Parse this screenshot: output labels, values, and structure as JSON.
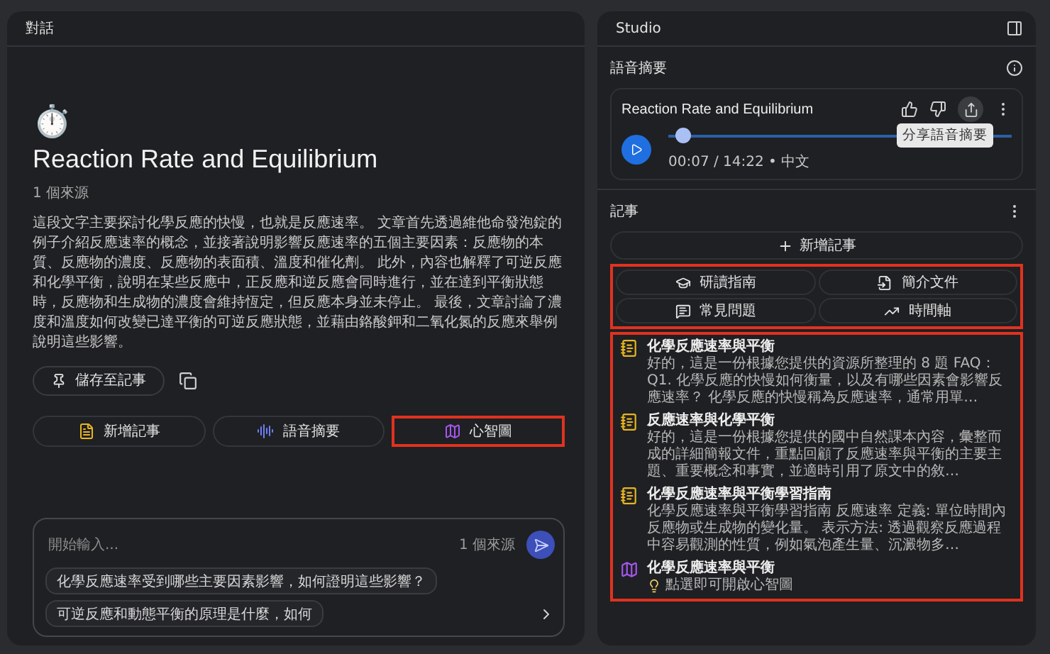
{
  "chat": {
    "title": "對話",
    "emoji": "⏱️",
    "notebook_title": "Reaction Rate and Equilibrium",
    "source_count": "1 個來源",
    "summary": "這段文字主要探討化學反應的快慢，也就是反應速率。 文章首先透過維他命發泡錠的例子介紹反應速率的概念，並接著說明影響反應速率的五個主要因素：反應物的本質、反應物的濃度、反應物的表面積、溫度和催化劑。 此外，內容也解釋了可逆反應和化學平衡，說明在某些反應中，正反應和逆反應會同時進行，並在達到平衡狀態時，反應物和生成物的濃度會維持恆定，但反應本身並未停止。 最後，文章討論了濃度和溫度如何改變已達平衡的可逆反應狀態，並藉由鉻酸鉀和二氧化氮的反應來舉例說明這些影響。",
    "save_button": "儲存至記事",
    "actions": [
      {
        "kind": "note",
        "label": "新增記事",
        "highlighted": false
      },
      {
        "kind": "audio",
        "label": "語音摘要",
        "highlighted": false
      },
      {
        "kind": "mindmap",
        "label": "心智圖",
        "highlighted": true
      }
    ],
    "input": {
      "placeholder": "開始輸入...",
      "source_count": "1 個來源"
    },
    "suggestions": [
      "化學反應速率受到哪些主要因素影響，如何證明這些影響？",
      "可逆反應和動態平衡的原理是什麼，如何"
    ]
  },
  "studio": {
    "title": "Studio",
    "audio_overview": {
      "heading": "語音摘要",
      "title": "Reaction Rate and Equilibrium",
      "level": 0.02,
      "time": "00:07 / 14:22 • 中文",
      "tooltip": "分享語音摘要"
    },
    "notes": {
      "heading": "記事",
      "add_button": "新增記事",
      "tools_highlighted": true,
      "tools": [
        {
          "kind": "guide",
          "label": "研讀指南"
        },
        {
          "kind": "doc",
          "label": "簡介文件"
        },
        {
          "kind": "faq",
          "label": "常見問題"
        },
        {
          "kind": "timeline",
          "label": "時間軸"
        }
      ],
      "list_highlighted": true,
      "items": [
        {
          "kind": "note",
          "title": "化學反應速率與平衡",
          "text": "好的，這是一份根據您提供的資源所整理的 8 題 FAQ： Q1. 化學反應的快慢如何衡量，以及有哪些因素會影響反應速率？ 化學反應的快慢稱為反應速率，通常用單…"
        },
        {
          "kind": "note",
          "title": "反應速率與化學平衡",
          "text": "好的，這是一份根據您提供的國中自然課本內容，彙整而成的詳細簡報文件，重點回顧了反應速率與平衡的主要主題、重要概念和事實，並適時引用了原文中的敘…"
        },
        {
          "kind": "note",
          "title": "化學反應速率與平衡學習指南",
          "text": "化學反應速率與平衡學習指南 反應速率 定義: 單位時間內反應物或生成物的變化量。 表示方法: 透過觀察反應過程中容易觀測的性質，例如氣泡產生量、沉澱物多…"
        },
        {
          "kind": "mindmap",
          "title": "化學反應速率與平衡",
          "text": "點選即可開啟心智圖"
        }
      ]
    }
  }
}
